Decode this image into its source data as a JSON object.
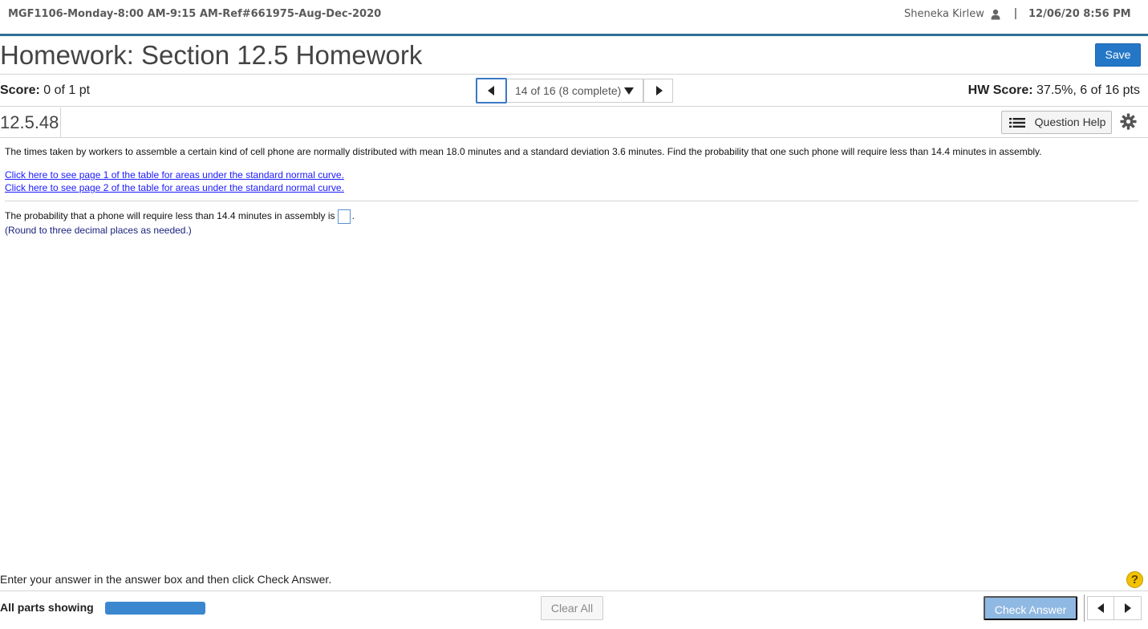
{
  "header": {
    "course": "MGF1106-Monday-8:00 AM-9:15 AM-Ref#661975-Aug-Dec-2020",
    "user_name": "Sheneka Kirlew",
    "separator": "|",
    "datetime": "12/06/20 8:56 PM"
  },
  "title": "Homework: Section 12.5 Homework",
  "save_label": "Save",
  "score": {
    "label": "Score:",
    "value": "0 of 1 pt"
  },
  "navigator": {
    "position": "14 of 16 (8 complete)"
  },
  "hw_score": {
    "label": "HW Score:",
    "value": "37.5%, 6 of 16 pts"
  },
  "question_id": "12.5.48",
  "question_help_label": "Question Help",
  "question": {
    "text": "The times taken by workers to assemble a certain kind of cell phone are normally distributed with mean 18.0 minutes and a standard deviation 3.6 minutes. Find the probability that one such phone will require less than 14.4 minutes in assembly.",
    "link1": "Click here to see page 1 of the table for areas under the standard normal curve.",
    "link2": "Click here to see page 2 of the table for areas under the standard normal curve.",
    "answer_prefix": "The probability that a phone will require less than 14.4 minutes in assembly is",
    "answer_suffix": ".",
    "answer_value": "",
    "round_note": "(Round to three decimal places as needed.)"
  },
  "footer": {
    "instruction": "Enter your answer in the answer box and then click Check Answer.",
    "help_glyph": "?",
    "parts_label": "All parts showing",
    "progress_fraction": 1.0,
    "clear_label": "Clear All",
    "check_label": "Check Answer"
  },
  "colors": {
    "accent": "#2477c6",
    "header_rule": "#2f6f94",
    "progress": "#3a87cf",
    "check_disabled": "#8fb8e2",
    "help_yellow": "#f2c200"
  },
  "icons": [
    "user-icon",
    "prev-arrow-icon",
    "dropdown-caret-icon",
    "next-arrow-icon",
    "list-icon",
    "gear-icon",
    "help-icon"
  ]
}
